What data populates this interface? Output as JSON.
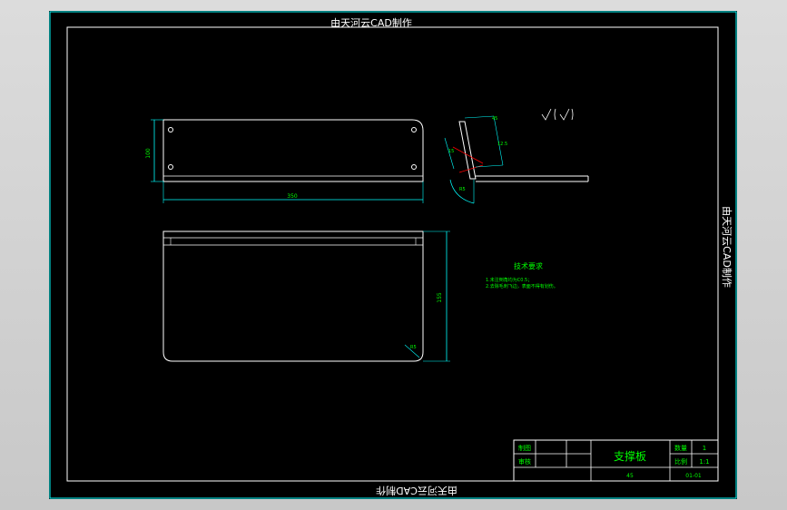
{
  "title_block": {
    "watermark_top": "由天河云CAD制作",
    "watermark_bottom": "由天河云CAD制作",
    "watermark_side": "由天河云CAD制作",
    "part_name": "支撑板",
    "label_draw": "制图",
    "label_check": "审核",
    "label_qty": "数量",
    "label_scale": "比例",
    "qty_value": "1",
    "scale_value": "1:1",
    "material": "45",
    "drawing_no": "01-01"
  },
  "tech_req": {
    "title": "技术要求",
    "line1": "1.未注倒角均为C0.5；",
    "line2": "2.去除毛刺飞边，表面不得有划伤。"
  },
  "dimensions": {
    "top_length": "350",
    "top_height": "100",
    "front_height": "155",
    "radius": "R5",
    "bend_a": "45",
    "bend_b": "12.5",
    "bend_c": "15",
    "bend_r": "R5"
  },
  "colors": {
    "background": "#000000",
    "frame": "#00ffff",
    "geometry": "#ffffff",
    "text": "#00ff00",
    "centerline": "#ff0000"
  }
}
